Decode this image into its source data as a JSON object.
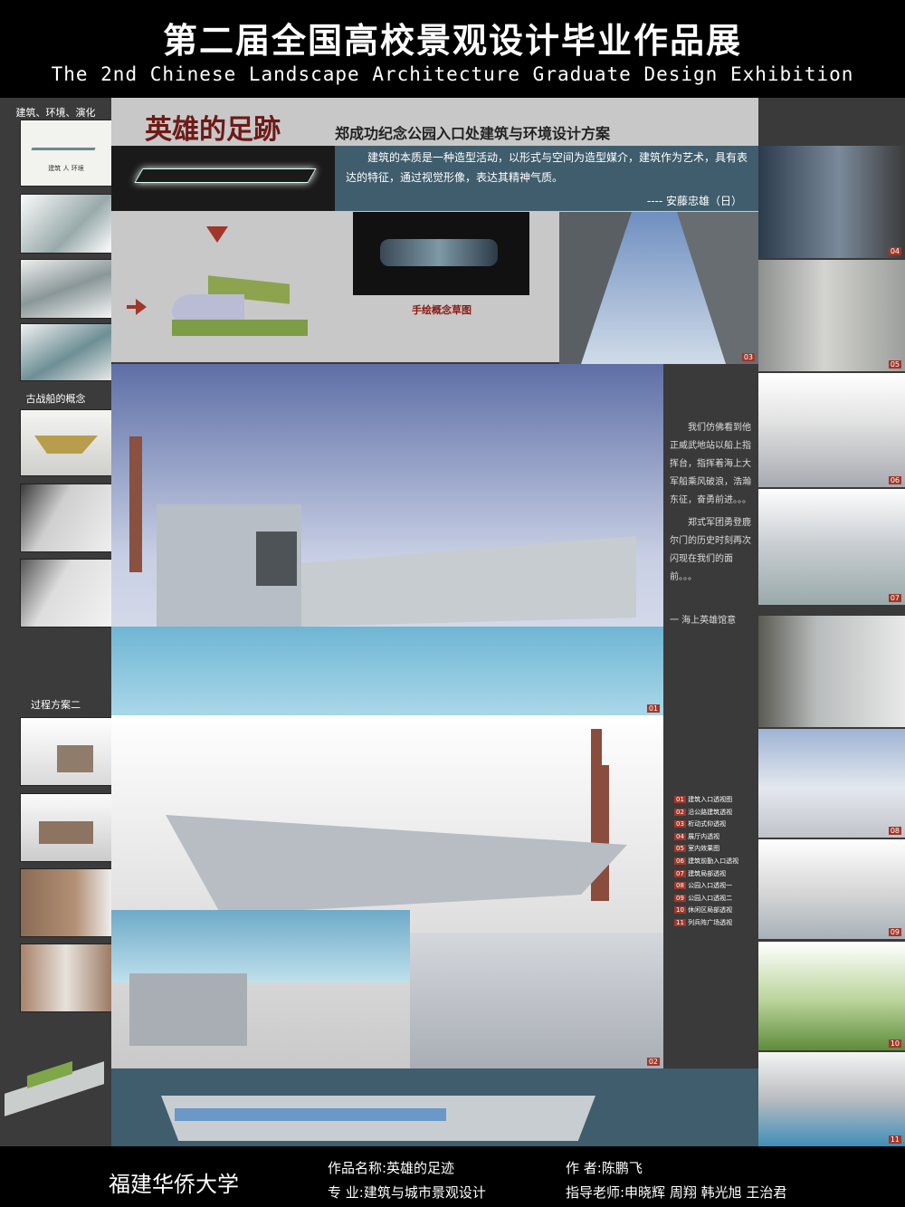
{
  "header": {
    "title_cn": "第二届全国高校景观设计毕业作品展",
    "title_en": "The 2nd Chinese Landscape Architecture Graduate Design Exhibition"
  },
  "sidebar": {
    "section1": "建筑、环境、演化",
    "section1_img_text": "建筑 人 环境",
    "section2": "古战船的概念",
    "section3": "过程方案二"
  },
  "intro": {
    "logo_title": "英雄的足跡",
    "project_title": "郑成功纪念公园入口处建筑与环境设计方案",
    "quote": "建筑的本质是一种造型活动，以形式与空间为造型媒介，建筑作为艺术，具有表达的特征，通过视觉形像，表达其精神气质。",
    "quote_author": "---- 安藤忠雄（日）",
    "sketch_caption": "手绘概念草图"
  },
  "poem": {
    "p1": "我们仿佛看到他正威武地站以船上指挥台，指挥着海上大军船乘风破浪，浩瀚东征，奋勇前进。。。",
    "p2": "郑式军团勇登鹿尔门的历史时刻再次闪现在我们的面前。。。",
    "sign": "一 海上英雄馆意"
  },
  "legend": [
    {
      "num": "01",
      "text": "建筑入口透视图"
    },
    {
      "num": "02",
      "text": "沿公路建筑透视"
    },
    {
      "num": "03",
      "text": "析动式仰透视"
    },
    {
      "num": "04",
      "text": "展厅内透视"
    },
    {
      "num": "05",
      "text": "室内效果图"
    },
    {
      "num": "06",
      "text": "建筑前勤入口透视"
    },
    {
      "num": "07",
      "text": "建筑局部透视"
    },
    {
      "num": "08",
      "text": "公园入口透视一"
    },
    {
      "num": "09",
      "text": "公园入口透视二"
    },
    {
      "num": "10",
      "text": "休闲区局部透视"
    },
    {
      "num": "11",
      "text": "列兵阵广场透视"
    }
  ],
  "image_numbers": [
    "01",
    "02",
    "03",
    "04",
    "05",
    "06",
    "07",
    "08",
    "09",
    "10",
    "11"
  ],
  "footer": {
    "school": "福建华侨大学",
    "work_label": "作品名称:英雄的足迹",
    "author_label": "作        者:陈鹏飞",
    "major_label": "专        业:建筑与城市景观设计",
    "advisor_label": "指导老师:申晓辉  周翔  韩光旭  王治君"
  },
  "colors": {
    "accent_red": "#a0372a",
    "title_dark_red": "#6e1a16",
    "panel_blue": "#3f5d6c"
  }
}
